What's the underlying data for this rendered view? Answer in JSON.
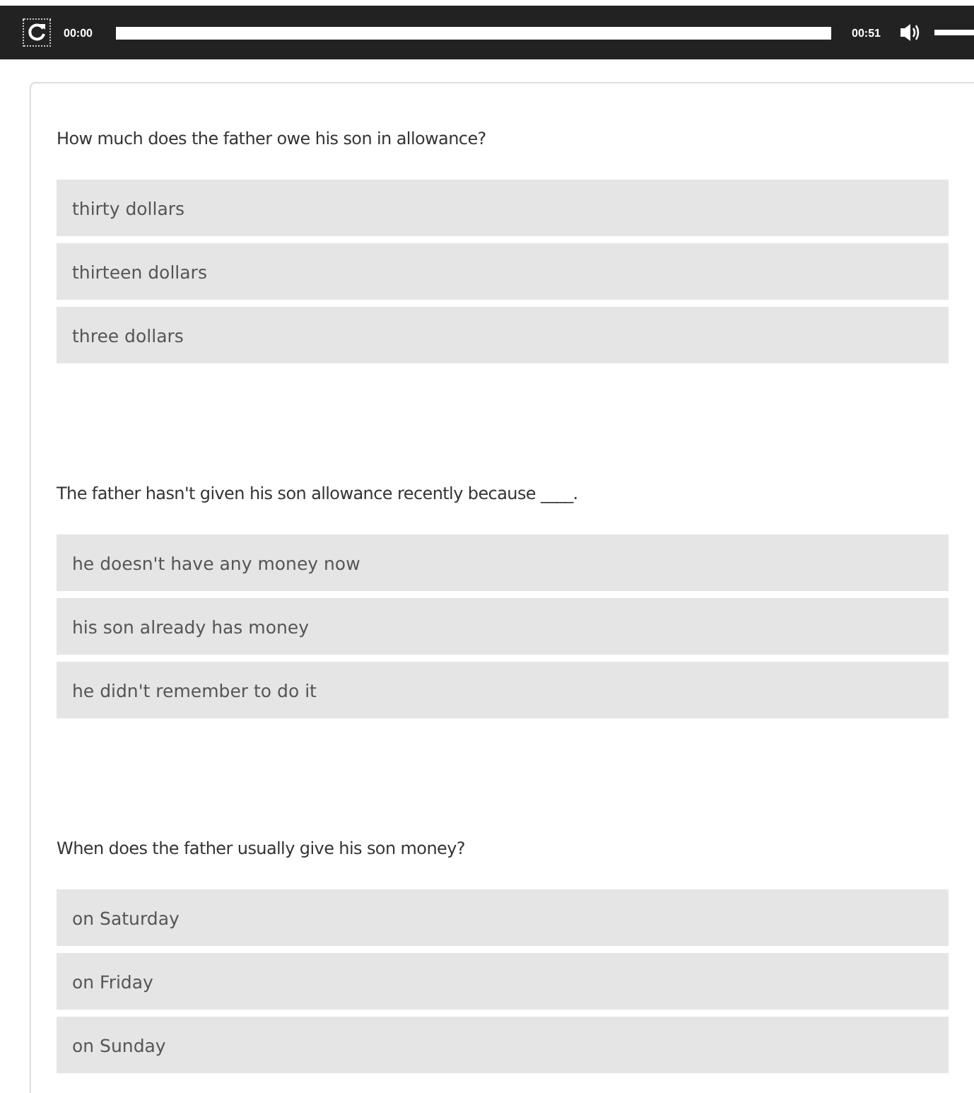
{
  "player": {
    "current_time": "00:00",
    "duration": "00:51"
  },
  "questions": [
    {
      "text": "How much does the father owe his son in allowance?",
      "options": [
        "thirty dollars",
        "thirteen dollars",
        "three dollars"
      ]
    },
    {
      "text": "The father hasn't given his son allowance recently because ____.",
      "options": [
        "he doesn't have any money now",
        "his son already has money",
        "he didn't remember to do it"
      ]
    },
    {
      "text": "When does the father usually give his son money?",
      "options": [
        "on Saturday",
        "on Friday",
        "on Sunday"
      ]
    }
  ]
}
